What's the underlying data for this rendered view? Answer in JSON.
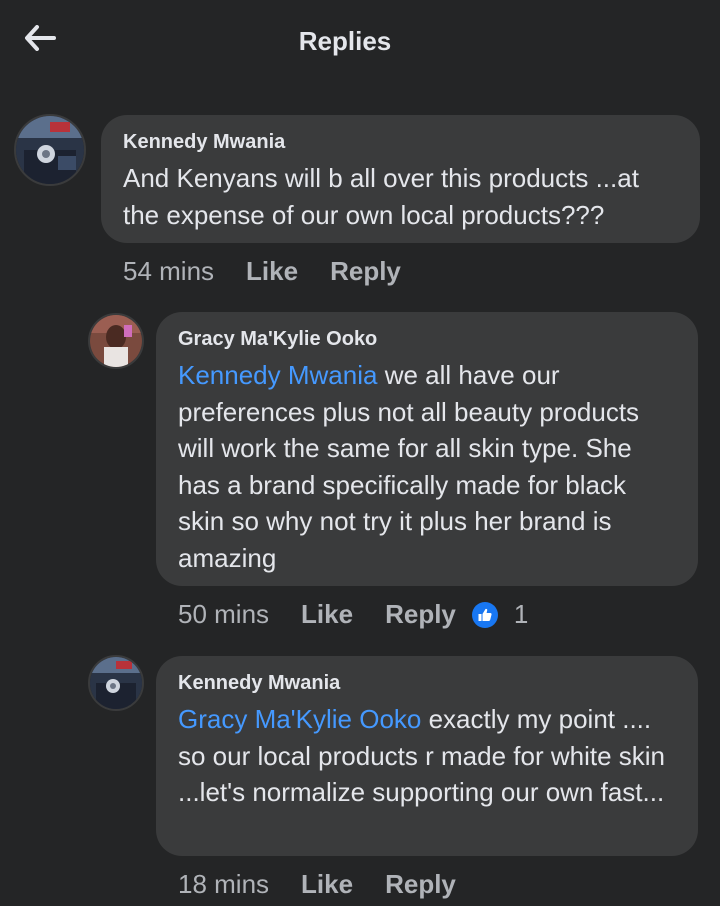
{
  "header": {
    "title": "Replies",
    "back_icon": "arrow-left-icon"
  },
  "colors": {
    "background": "#242526",
    "bubble": "#3a3b3c",
    "mention": "#4599ff",
    "like_badge": "#1877f2"
  },
  "comments": [
    {
      "author": "Kennedy Mwania",
      "mention": "",
      "text": "And Kenyans will b all over this products ...at the expense of our own local products???",
      "time": "54 mins",
      "like_label": "Like",
      "reply_label": "Reply",
      "reaction_count": ""
    },
    {
      "author": "Gracy Ma'Kylie Ooko",
      "mention": "Kennedy Mwania",
      "text": " we all have our preferences plus not all beauty products will work the same for all skin type. She has a brand specifically made for black skin so why not try it plus her brand is amazing",
      "time": "50 mins",
      "like_label": "Like",
      "reply_label": "Reply",
      "reaction_count": "1"
    },
    {
      "author": "Kennedy Mwania",
      "mention": "Gracy Ma'Kylie Ooko",
      "text": " exactly my point .... so our local products r made for white skin ...let's normalize supporting our own fast...",
      "time": "18 mins",
      "like_label": "Like",
      "reply_label": "Reply",
      "reaction_count": ""
    }
  ]
}
